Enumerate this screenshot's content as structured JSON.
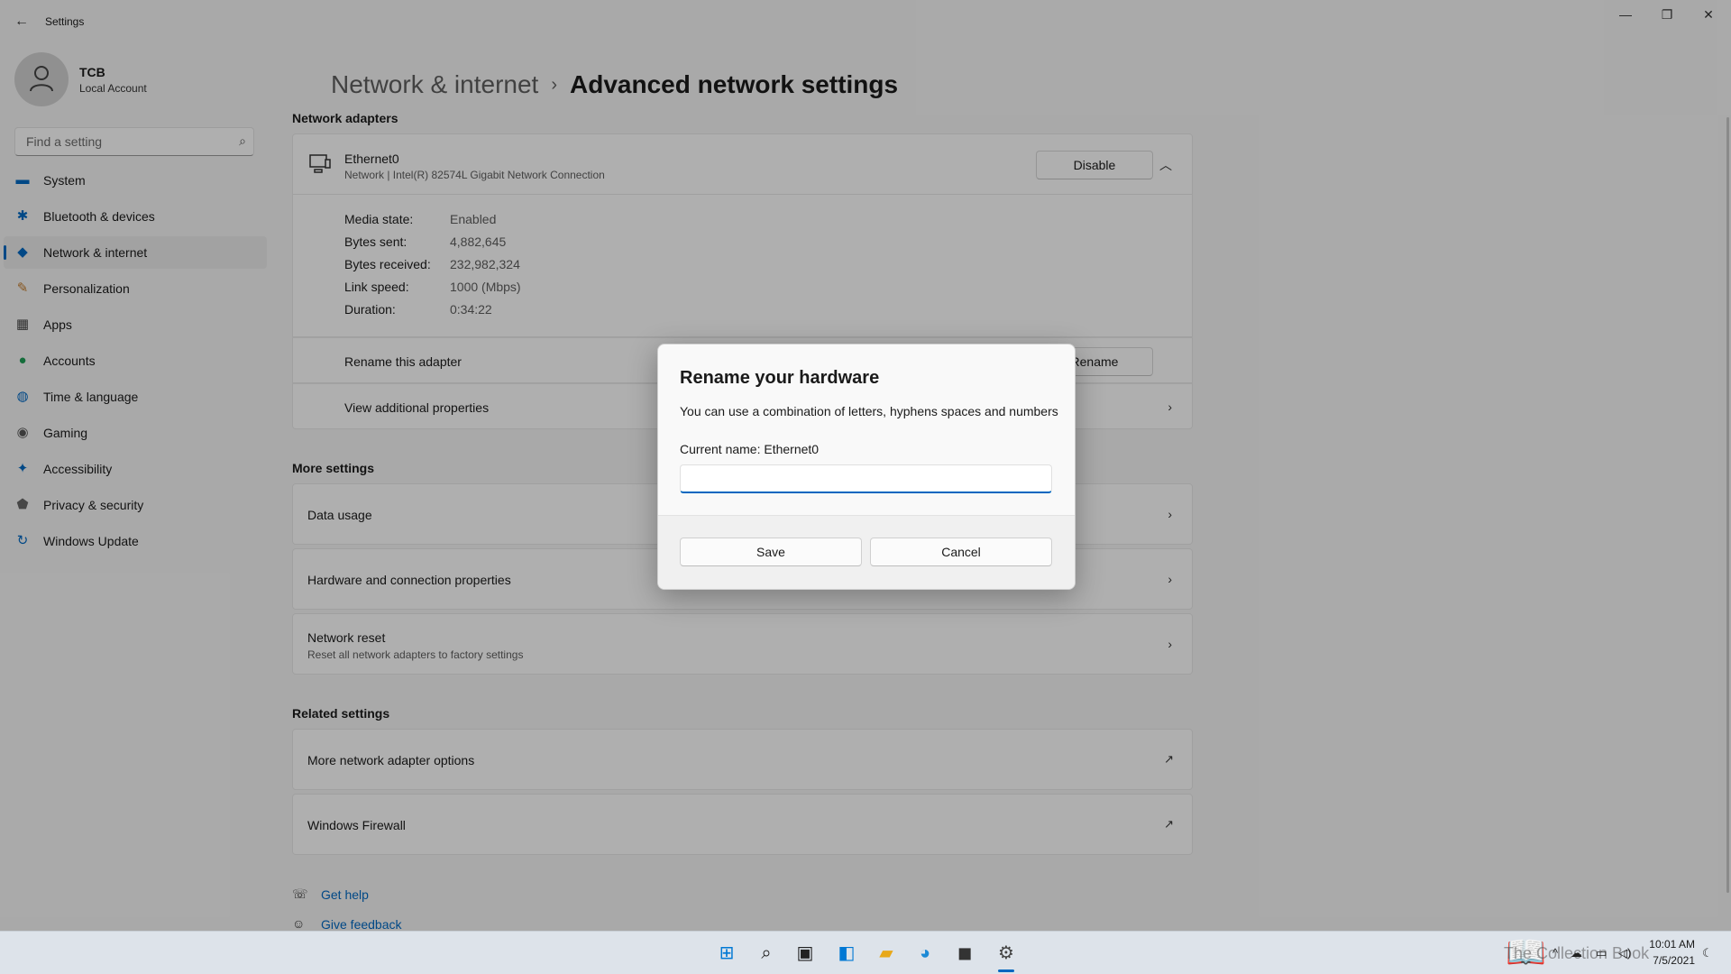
{
  "window": {
    "title": "Settings",
    "minimize": "—",
    "restore": "❐",
    "close": "✕",
    "back": "←"
  },
  "profile": {
    "name": "TCB",
    "account_type": "Local Account"
  },
  "search": {
    "placeholder": "Find a setting",
    "value": ""
  },
  "nav": {
    "items": [
      {
        "label": "System",
        "icon": "system-icon",
        "glyph": "▬",
        "color": "#0067c0"
      },
      {
        "label": "Bluetooth & devices",
        "icon": "bluetooth-icon",
        "glyph": "✱",
        "color": "#0067c0"
      },
      {
        "label": "Network & internet",
        "icon": "wifi-icon",
        "glyph": "◆",
        "color": "#0067c0",
        "active": true
      },
      {
        "label": "Personalization",
        "icon": "brush-icon",
        "glyph": "✎",
        "color": "#c07a2a"
      },
      {
        "label": "Apps",
        "icon": "apps-icon",
        "glyph": "▦",
        "color": "#444"
      },
      {
        "label": "Accounts",
        "icon": "accounts-icon",
        "glyph": "●",
        "color": "#1f9d55"
      },
      {
        "label": "Time & language",
        "icon": "globe-icon",
        "glyph": "◍",
        "color": "#0067c0"
      },
      {
        "label": "Gaming",
        "icon": "gamepad-icon",
        "glyph": "◉",
        "color": "#555"
      },
      {
        "label": "Accessibility",
        "icon": "accessibility-icon",
        "glyph": "✦",
        "color": "#0067c0"
      },
      {
        "label": "Privacy & security",
        "icon": "shield-icon",
        "glyph": "⬟",
        "color": "#666"
      },
      {
        "label": "Windows Update",
        "icon": "update-icon",
        "glyph": "↻",
        "color": "#0067c0"
      }
    ]
  },
  "breadcrumb": {
    "parent": "Network & internet",
    "separator": "›",
    "current": "Advanced network settings"
  },
  "adapters": {
    "section_title": "Network adapters",
    "adapter": {
      "name": "Ethernet0",
      "description": "Network | Intel(R) 82574L Gigabit Network Connection",
      "disable_label": "Disable",
      "properties": [
        {
          "label": "Media state:",
          "value": "Enabled"
        },
        {
          "label": "Bytes sent:",
          "value": "4,882,645"
        },
        {
          "label": "Bytes received:",
          "value": "232,982,324"
        },
        {
          "label": "Link speed:",
          "value": "1000 (Mbps)"
        },
        {
          "label": "Duration:",
          "value": "0:34:22"
        }
      ],
      "rename_label": "Rename this adapter",
      "rename_button": "Rename",
      "view_props_label": "View additional properties"
    }
  },
  "more_settings": {
    "section_title": "More settings",
    "items": [
      {
        "title": "Data usage"
      },
      {
        "title": "Hardware and connection properties"
      },
      {
        "title": "Network reset",
        "subtitle": "Reset all network adapters to factory settings"
      }
    ]
  },
  "related_settings": {
    "section_title": "Related settings",
    "items": [
      {
        "title": "More network adapter options"
      },
      {
        "title": "Windows Firewall"
      }
    ]
  },
  "help": {
    "get_help": "Get help",
    "give_feedback": "Give feedback"
  },
  "dialog": {
    "title": "Rename your hardware",
    "description": "You can use a combination of letters, hyphens spaces and numbers",
    "current_name_label": "Current name: Ethernet0",
    "input_value": "",
    "save_label": "Save",
    "cancel_label": "Cancel"
  },
  "taskbar": {
    "icons": [
      {
        "name": "start-icon",
        "glyph": "⊞",
        "color": "#0078d4"
      },
      {
        "name": "search-icon",
        "glyph": "⌕",
        "color": "#222"
      },
      {
        "name": "task-view-icon",
        "glyph": "▣",
        "color": "#222"
      },
      {
        "name": "widgets-icon",
        "glyph": "◧",
        "color": "#0078d4"
      },
      {
        "name": "file-explorer-icon",
        "glyph": "▰",
        "color": "#e8a818"
      },
      {
        "name": "edge-icon",
        "glyph": "◕",
        "color": "#1c8ad6"
      },
      {
        "name": "store-icon",
        "glyph": "◼",
        "color": "#333"
      },
      {
        "name": "settings-icon",
        "glyph": "⚙",
        "color": "#444"
      }
    ],
    "clock_time": "10:01 AM",
    "clock_date": "7/5/2021",
    "watermark": "The Collection Book"
  }
}
